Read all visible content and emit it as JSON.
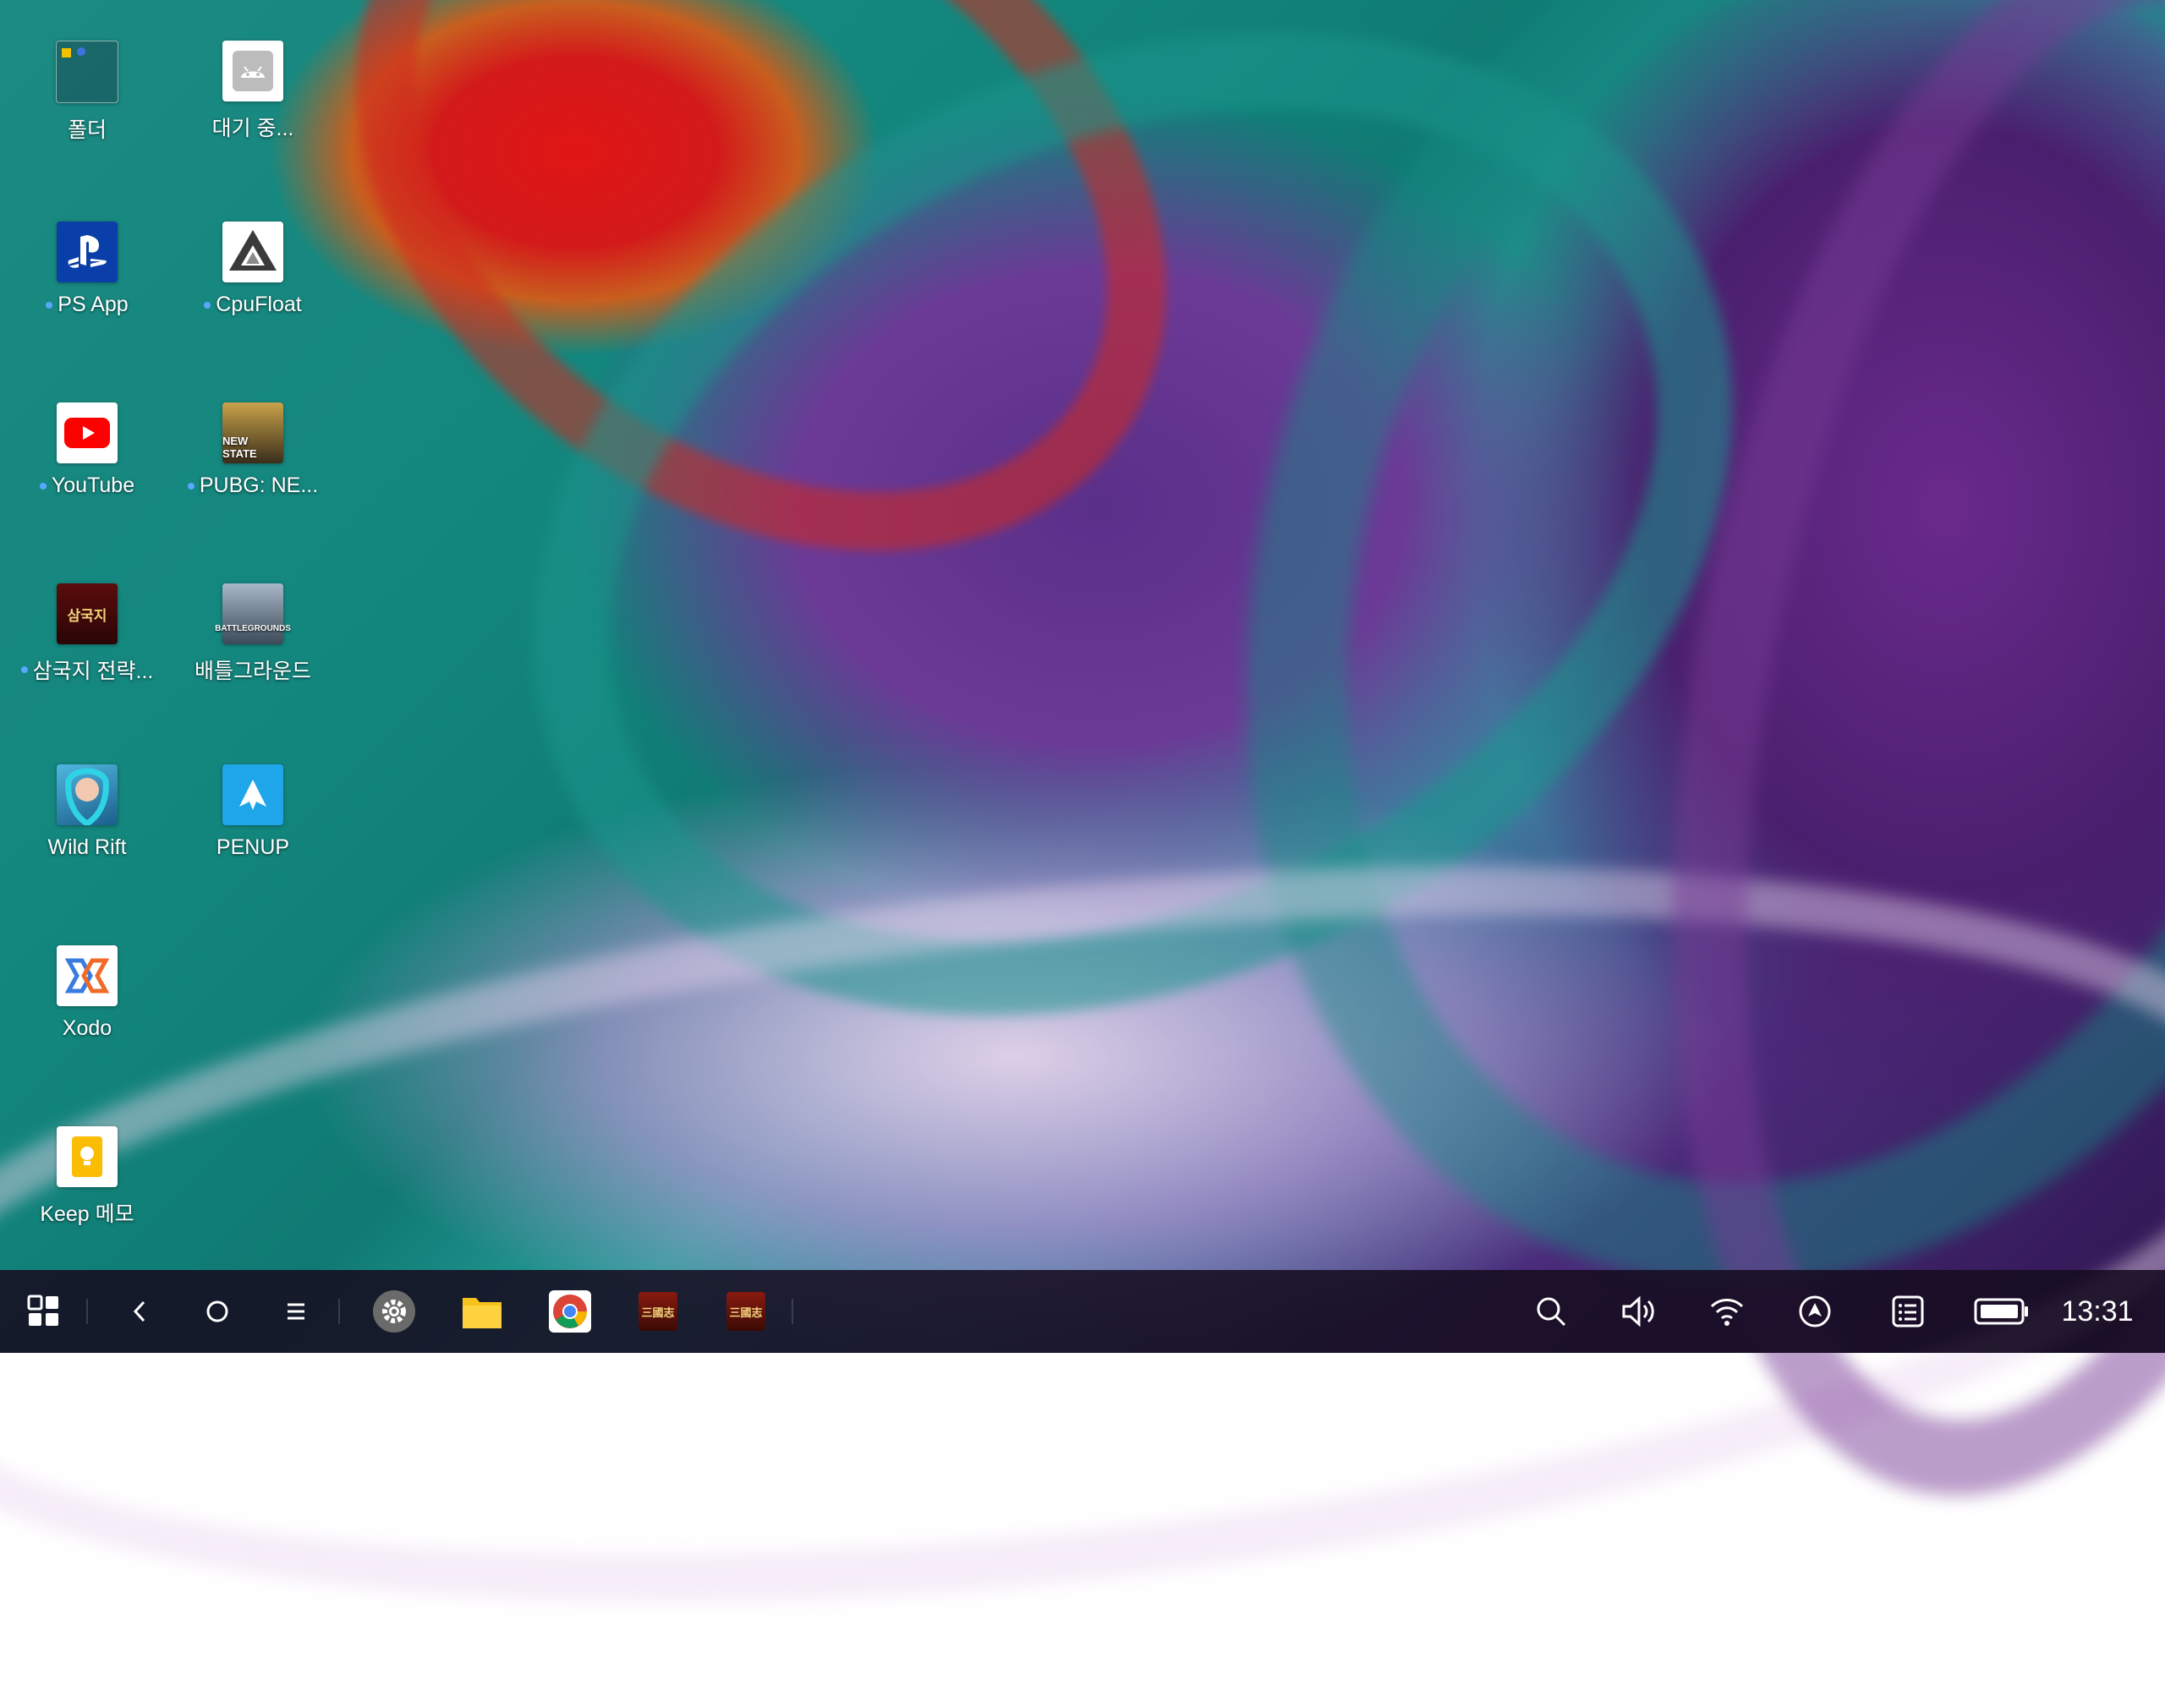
{
  "desktop": {
    "icons": [
      {
        "id": "folder",
        "label": "폴더",
        "has_dot": false
      },
      {
        "id": "waiting",
        "label": "대기 중...",
        "has_dot": false
      },
      {
        "id": "ps-app",
        "label": "PS App",
        "has_dot": true
      },
      {
        "id": "cpufloat",
        "label": "CpuFloat",
        "has_dot": true
      },
      {
        "id": "youtube",
        "label": "YouTube",
        "has_dot": true
      },
      {
        "id": "pubg-ns",
        "label": "PUBG: NE...",
        "has_dot": true
      },
      {
        "id": "samgukji",
        "label": "삼국지 전략...",
        "has_dot": true
      },
      {
        "id": "battlegrounds",
        "label": "배틀그라운드",
        "has_dot": false
      },
      {
        "id": "wildrift",
        "label": "Wild Rift",
        "has_dot": false
      },
      {
        "id": "penup",
        "label": "PENUP",
        "has_dot": false
      },
      {
        "id": "xodo",
        "label": "Xodo",
        "has_dot": false
      },
      {
        "id": "keep",
        "label": "Keep 메모",
        "has_dot": false
      }
    ],
    "icon_texts": {
      "pubg_newstate": "NEW STATE",
      "battlegrounds": "BATTLEGROUNDS",
      "samgukji": "삼국지"
    }
  },
  "taskbar": {
    "clock": "13:31",
    "pinned": [
      "settings",
      "files",
      "chrome",
      "samgukji-1",
      "samgukji-2"
    ],
    "tray": [
      "search-icon",
      "volume-icon",
      "wifi-icon",
      "navigation-icon",
      "notifications-icon",
      "battery-icon"
    ]
  },
  "colors": {
    "taskbar_bg": "#160c20",
    "accent_dot": "#5aa7ff"
  }
}
